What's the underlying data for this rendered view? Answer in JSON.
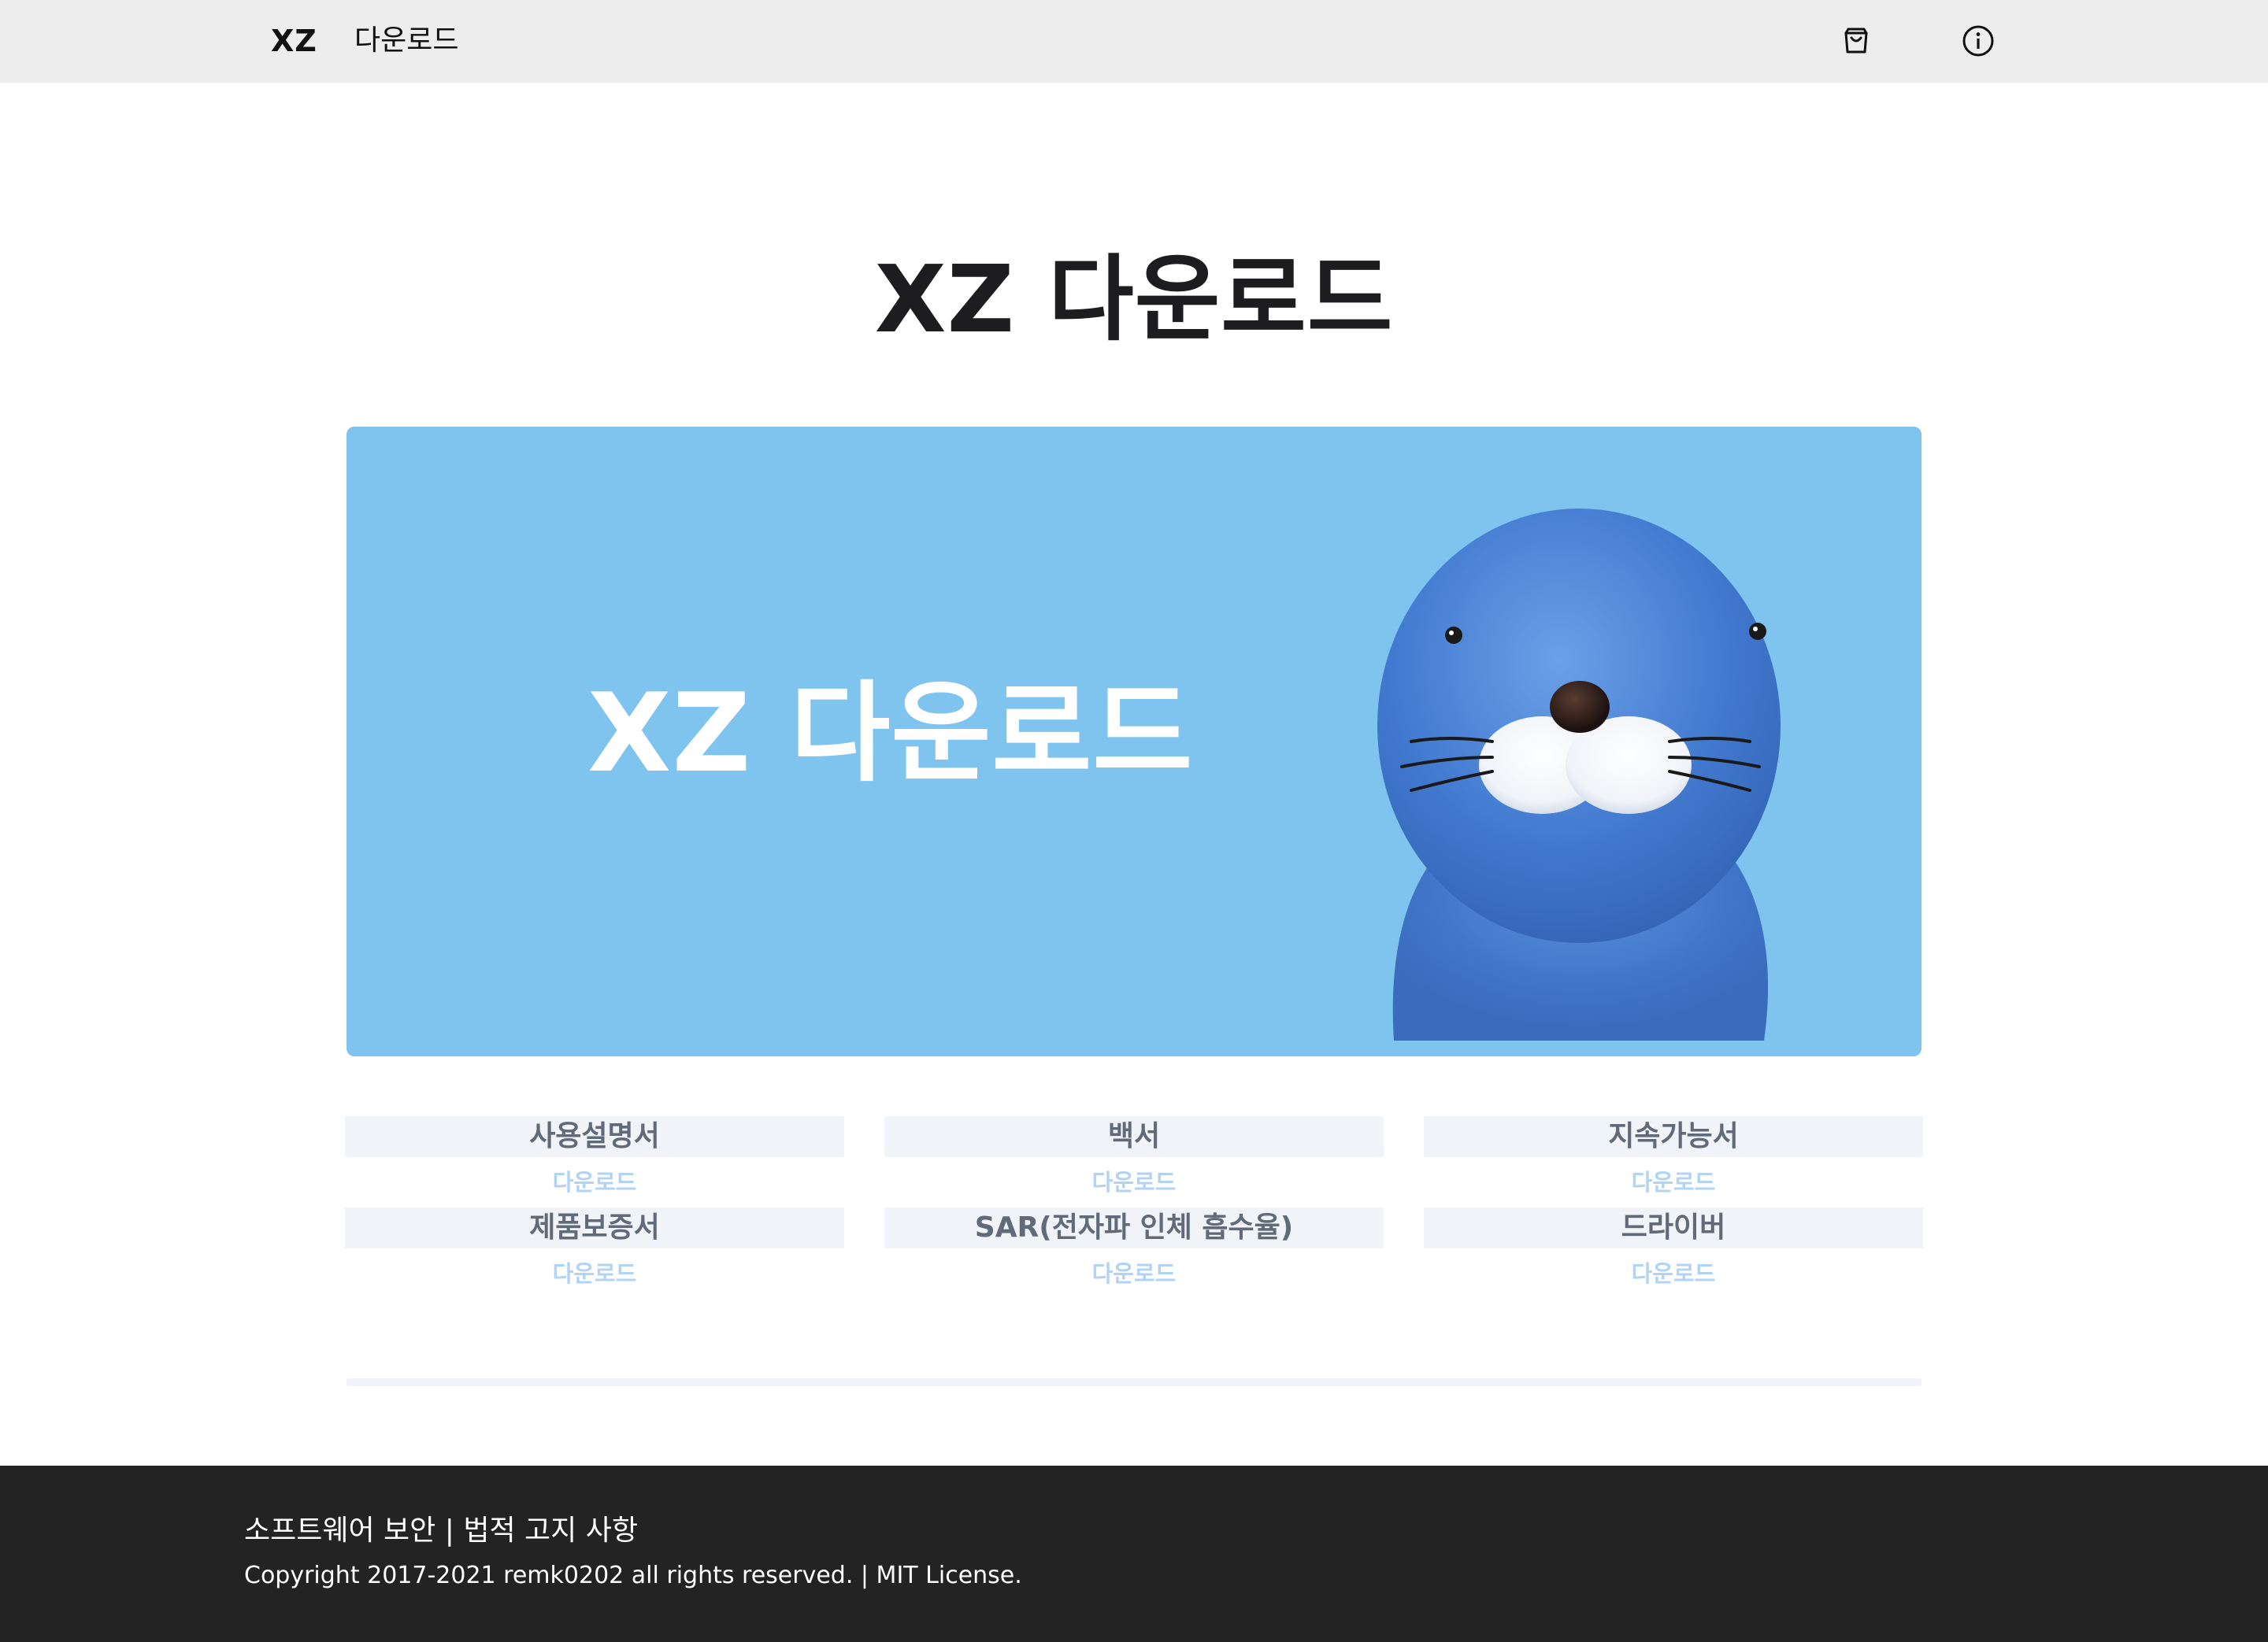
{
  "nav": {
    "logo": "XZ",
    "link": "다운로드",
    "icons": [
      "shopping-bag-icon",
      "info-icon"
    ]
  },
  "page": {
    "title": "XZ 다운로드"
  },
  "hero": {
    "text": "XZ 다운로드",
    "background": "#7fc3ef"
  },
  "downloads": [
    {
      "title": "사용설명서",
      "link": "다운로드"
    },
    {
      "title": "백서",
      "link": "다운로드"
    },
    {
      "title": "지속가능서",
      "link": "다운로드"
    },
    {
      "title": "제품보증서",
      "link": "다운로드"
    },
    {
      "title": "SAR(전자파 인체 흡수율)",
      "link": "다운로드"
    },
    {
      "title": "드라이버",
      "link": "다운로드"
    }
  ],
  "footer": {
    "link_security": "소프트웨어 보안",
    "separator": "|",
    "link_legal": "법적 고지 사항",
    "copyright": "Copyright 2017-2021 remk0202 all rights reserved. | MIT License."
  },
  "colors": {
    "nav_bg": "#ededed",
    "footer_bg": "#232323",
    "card_title_bg": "#f0f3f7",
    "card_title_text": "#606a78",
    "download_link": "#b2d3f2"
  }
}
